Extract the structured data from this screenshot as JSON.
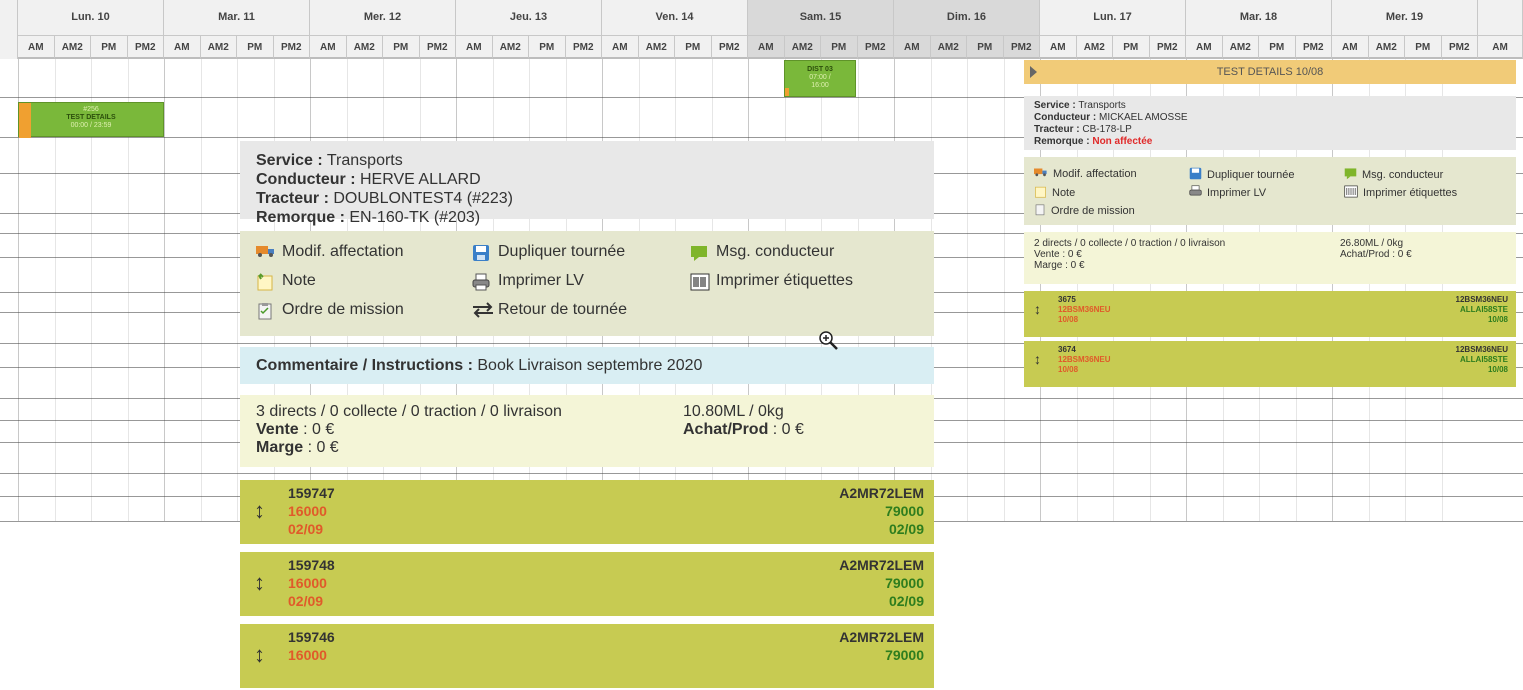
{
  "calendar": {
    "days": [
      {
        "label": "Lun. 10",
        "weekend": false
      },
      {
        "label": "Mar. 11",
        "weekend": false
      },
      {
        "label": "Mer. 12",
        "weekend": false
      },
      {
        "label": "Jeu. 13",
        "weekend": false
      },
      {
        "label": "Ven. 14",
        "weekend": false
      },
      {
        "label": "Sam. 15",
        "weekend": true
      },
      {
        "label": "Dim. 16",
        "weekend": true
      },
      {
        "label": "Lun. 17",
        "weekend": false
      },
      {
        "label": "Mar. 18",
        "weekend": false
      },
      {
        "label": "Mer. 19",
        "weekend": false
      }
    ],
    "slots": [
      "AM",
      "AM2",
      "PM",
      "PM2"
    ],
    "extra_slot": "AM"
  },
  "events": {
    "dist": {
      "title": "DIST 03",
      "time1": "07:00 /",
      "time2": "16:00"
    },
    "test": {
      "num": "#256",
      "title": "TEST DETAILS",
      "time": "00:00 / 23:59"
    }
  },
  "popup": {
    "service_label": "Service :",
    "service": "Transports",
    "driver_label": "Conducteur :",
    "driver": "HERVE ALLARD",
    "tractor_label": "Tracteur :",
    "tractor": "DOUBLONTEST4 (#223)",
    "trailer_label": "Remorque :",
    "trailer": "EN-160-TK (#203)",
    "actions": {
      "modif": "Modif. affectation",
      "dupliquer": "Dupliquer tournée",
      "msg": "Msg. conducteur",
      "note": "Note",
      "imprimer_lv": "Imprimer LV",
      "etiquettes": "Imprimer étiquettes",
      "ordre": "Ordre de mission",
      "retour": "Retour de tournée"
    },
    "comment_label": "Commentaire / Instructions :",
    "comment": "Book Livraison septembre 2020",
    "summary": "3 directs / 0 collecte / 0 traction / 0 livraison",
    "vente_label": "Vente",
    "vente": " : 0 €",
    "marge_label": "Marge",
    "marge": " : 0 €",
    "weight": "10.80ML / 0kg",
    "achat_label": "Achat/Prod",
    "achat": " : 0 €",
    "cards": [
      {
        "id": "159747",
        "code": "16000",
        "date": "02/09",
        "dest": "A2MR72LEM",
        "dest_code": "79000",
        "dest_date": "02/09"
      },
      {
        "id": "159748",
        "code": "16000",
        "date": "02/09",
        "dest": "A2MR72LEM",
        "dest_code": "79000",
        "dest_date": "02/09"
      },
      {
        "id": "159746",
        "code": "16000",
        "date": "",
        "dest": "A2MR72LEM",
        "dest_code": "79000",
        "dest_date": ""
      }
    ]
  },
  "rpopup": {
    "title": "TEST DETAILS 10/08",
    "service_label": "Service :",
    "service": "Transports",
    "driver_label": "Conducteur :",
    "driver": "MICKAEL AMOSSE",
    "tractor_label": "Tracteur :",
    "tractor": "CB-178-LP",
    "trailer_label": "Remorque :",
    "trailer": "Non affectée",
    "actions": {
      "modif": "Modif. affectation",
      "dupliquer": "Dupliquer tournée",
      "msg": "Msg. conducteur",
      "note": "Note",
      "imprimer_lv": "Imprimer LV",
      "etiquettes": "Imprimer étiquettes",
      "ordre": "Ordre de mission"
    },
    "summary": "2 directs / 0 collecte / 0 traction / 0 livraison",
    "vente": "Vente : 0 €",
    "marge": "Marge : 0 €",
    "weight": "26.80ML / 0kg",
    "achat": "Achat/Prod : 0 €",
    "cards": [
      {
        "id": "3675",
        "code": "12BSM36NEU",
        "date": "10/08",
        "dest": "12BSM36NEU",
        "dest_code": "ALLAI58STE",
        "dest_date": "10/08"
      },
      {
        "id": "3674",
        "code": "12BSM36NEU",
        "date": "10/08",
        "dest": "12BSM36NEU",
        "dest_code": "ALLAI58STE",
        "dest_date": "10/08"
      }
    ]
  },
  "icons": {
    "truck": "truck-icon",
    "floppy": "floppy-icon",
    "chat": "chat-icon",
    "note": "note-icon",
    "printer": "printer-icon",
    "barcode": "barcode-icon",
    "clipboard": "clipboard-icon",
    "swap": "swap-arrows-icon",
    "zoom": "zoom-in-icon"
  },
  "colors": {
    "event_green": "#7ab83a",
    "card_green": "#c7cb52",
    "title_orange": "#f1cb78",
    "comment_blue": "#d9eef3"
  }
}
